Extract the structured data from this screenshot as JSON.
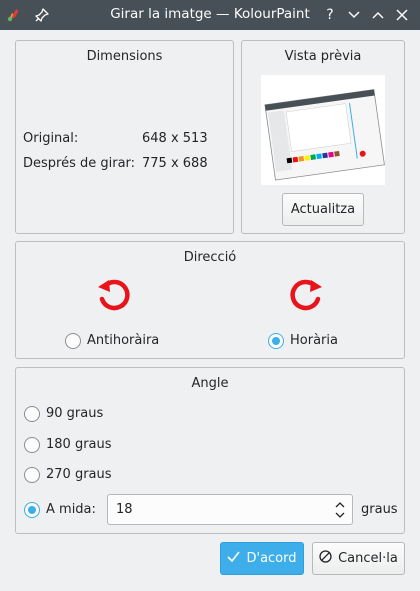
{
  "window": {
    "title": "Girar la imatge — KolourPaint",
    "help_glyph": "?"
  },
  "dimensions": {
    "title": "Dimensions",
    "original_label": "Original:",
    "original_value": "648 x 513",
    "after_label": "Després de girar:",
    "after_value": "775 x 688"
  },
  "preview": {
    "title": "Vista prèvia",
    "update_label": "Actualitza"
  },
  "direction": {
    "title": "Direcció",
    "ccw_label": "Antihoràira",
    "cw_label": "Horària",
    "selected": "cw",
    "arrow_color": "#e8141b"
  },
  "angle": {
    "title": "Angle",
    "options": [
      "90 graus",
      "180 graus",
      "270 graus"
    ],
    "custom_label": "A mida:",
    "custom_value": "18",
    "unit": "graus",
    "selected": "custom"
  },
  "buttons": {
    "ok_label": "D'acord",
    "cancel_label": "Cancel·la"
  },
  "colors": {
    "accent": "#3daee9",
    "titlebar": "#475057",
    "window_bg": "#eff0f1"
  }
}
